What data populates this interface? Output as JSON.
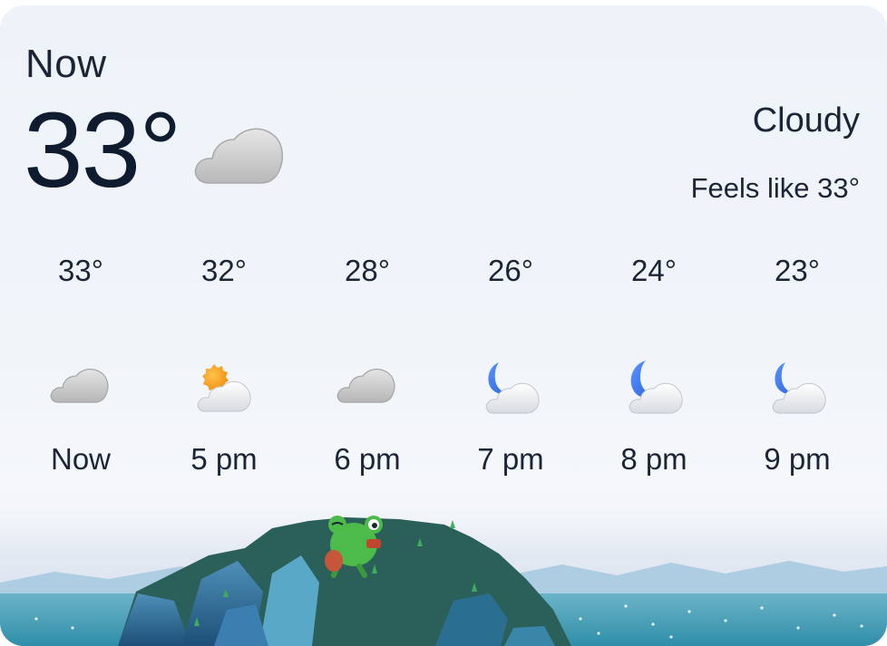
{
  "current": {
    "label": "Now",
    "temperature": "33°",
    "icon": "cloud-icon",
    "condition": "Cloudy",
    "feels_like": "Feels like 33°"
  },
  "hourly": [
    {
      "temp": "33°",
      "label": "Now",
      "icon": "cloud-icon"
    },
    {
      "temp": "32°",
      "label": "5 pm",
      "icon": "partly-sunny-icon"
    },
    {
      "temp": "28°",
      "label": "6 pm",
      "icon": "cloud-icon"
    },
    {
      "temp": "26°",
      "label": "7 pm",
      "icon": "partly-cloudy-night-icon"
    },
    {
      "temp": "24°",
      "label": "8 pm",
      "icon": "partly-cloudy-night-icon"
    },
    {
      "temp": "23°",
      "label": "9 pm",
      "icon": "partly-cloudy-night-icon"
    }
  ],
  "colors": {
    "text": "#1b2536",
    "cloud_gray": "#c9c9c9",
    "sun": "#f4a21c",
    "moon": "#3d7bf2",
    "mascot": "#4cbb4a"
  }
}
